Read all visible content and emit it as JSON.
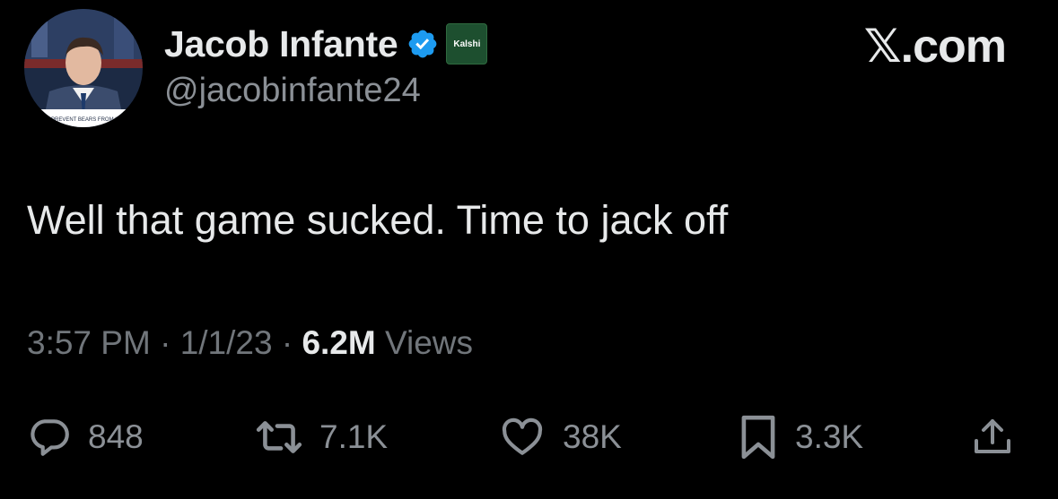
{
  "brand": "𝕏.com",
  "author": {
    "display_name": "Jacob Infante",
    "handle": "@jacobinfante24",
    "affiliate_badge_label": "Kalshi"
  },
  "avatar": {
    "caption": "PREVENT BEARS FROM LEA"
  },
  "tweet": {
    "text": "Well that game sucked. Time to jack off",
    "time": "3:57 PM",
    "date": "1/1/23",
    "separator": "·",
    "views_count": "6.2M",
    "views_label": "Views"
  },
  "actions": {
    "replies": "848",
    "reposts": "7.1K",
    "likes": "38K",
    "bookmarks": "3.3K"
  },
  "icons": {
    "reply": "speech-bubble-icon",
    "repost": "repost-arrows-icon",
    "like": "heart-icon",
    "bookmark": "bookmark-icon",
    "share": "share-upload-icon",
    "verified": "verified-check-icon"
  },
  "colors": {
    "background": "#000000",
    "primary_text": "#e7e9ea",
    "secondary_text": "#71767b",
    "verified_blue": "#1d9bf0",
    "affiliate_green": "#1d4f2f"
  }
}
